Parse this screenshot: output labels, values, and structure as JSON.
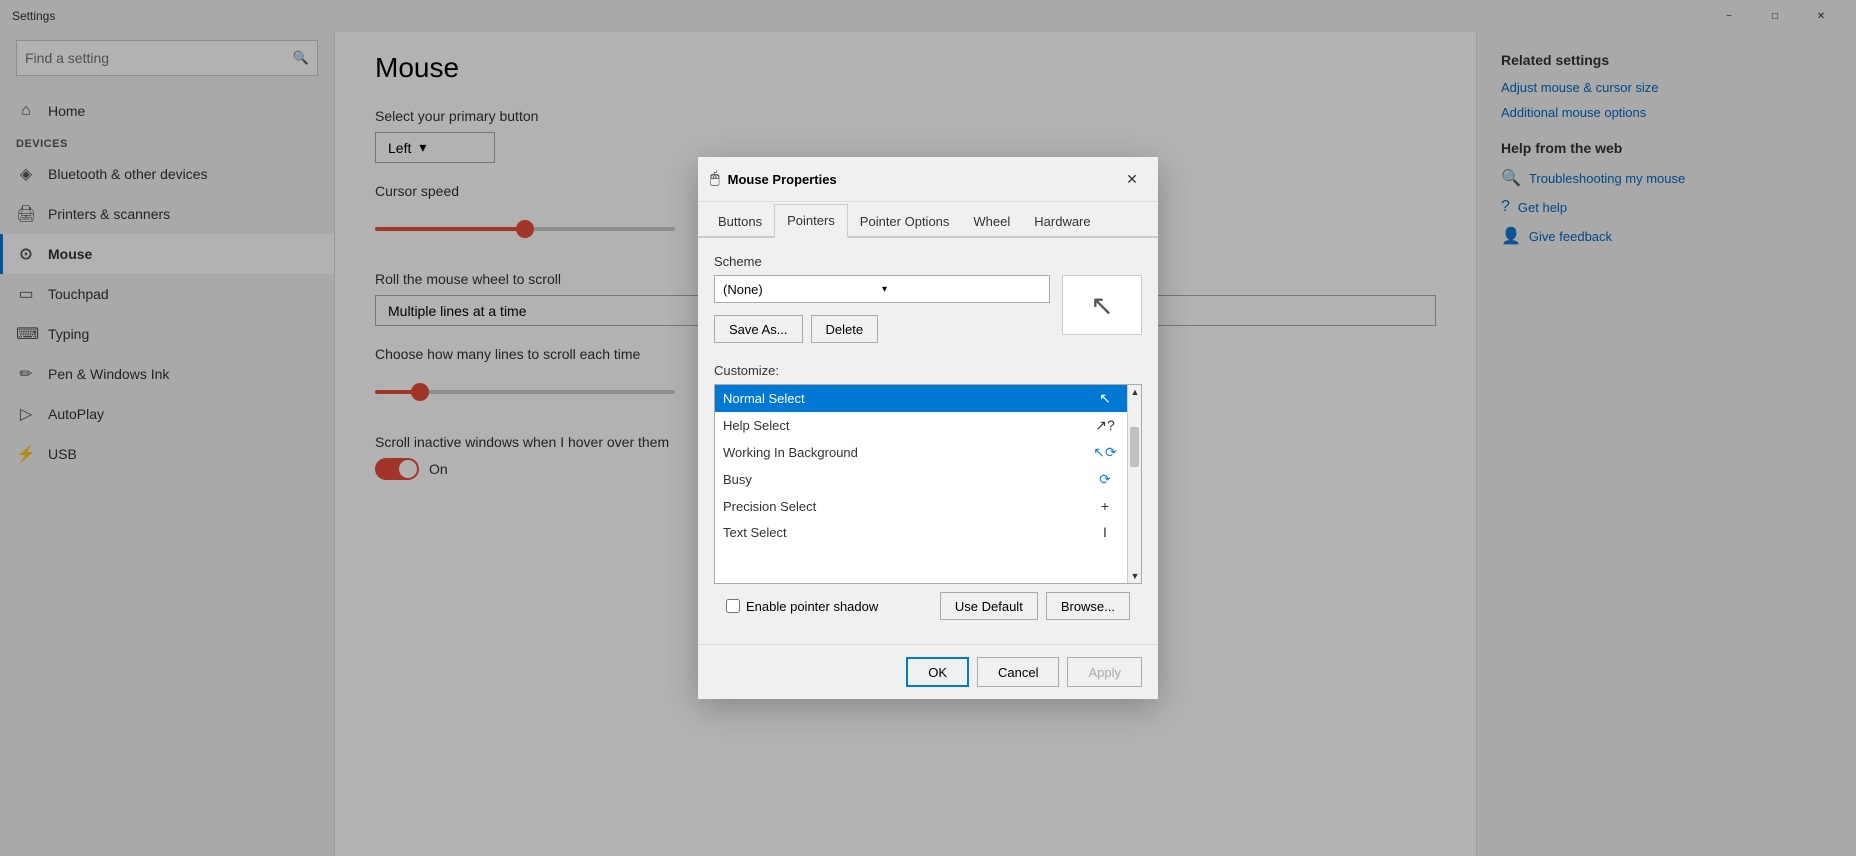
{
  "titlebar": {
    "title": "Settings",
    "minimize": "−",
    "maximize": "□",
    "close": "✕"
  },
  "sidebar": {
    "search_placeholder": "Find a setting",
    "section_label": "Devices",
    "nav_items": [
      {
        "id": "home",
        "icon": "⌂",
        "label": "Home"
      },
      {
        "id": "bluetooth",
        "icon": "◈",
        "label": "Bluetooth & other devices"
      },
      {
        "id": "printers",
        "icon": "🖨",
        "label": "Printers & scanners"
      },
      {
        "id": "mouse",
        "icon": "⊙",
        "label": "Mouse",
        "active": true
      },
      {
        "id": "touchpad",
        "icon": "▭",
        "label": "Touchpad"
      },
      {
        "id": "typing",
        "icon": "⌨",
        "label": "Typing"
      },
      {
        "id": "pen",
        "icon": "✏",
        "label": "Pen & Windows Ink"
      },
      {
        "id": "autoplay",
        "icon": "▷",
        "label": "AutoPlay"
      },
      {
        "id": "usb",
        "icon": "⚡",
        "label": "USB"
      }
    ]
  },
  "main": {
    "title": "Mouse",
    "primary_button_label": "Select your primary button",
    "primary_button_value": "Left",
    "cursor_speed_label": "Cursor speed",
    "cursor_speed_percent": 50,
    "scroll_label": "Roll the mouse wheel to scroll",
    "scroll_value": "Multiple lines at a time",
    "lines_label": "Choose how many lines to scroll each time",
    "lines_percent": 15,
    "inactive_label": "Scroll inactive windows when I hover over them",
    "inactive_value": "On"
  },
  "right_panel": {
    "related_title": "Related settings",
    "links": [
      {
        "label": "Adjust mouse & cursor size"
      },
      {
        "label": "Additional mouse options"
      }
    ],
    "help_title": "Help from the web",
    "help_links": [
      {
        "icon": "?",
        "label": "Troubleshooting my mouse"
      },
      {
        "icon": "?",
        "label": "Get help"
      },
      {
        "icon": "👤",
        "label": "Give feedback"
      }
    ]
  },
  "modal": {
    "icon": "🖱",
    "title": "Mouse Properties",
    "tabs": [
      "Buttons",
      "Pointers",
      "Pointer Options",
      "Wheel",
      "Hardware"
    ],
    "active_tab": "Pointers",
    "scheme_label": "Scheme",
    "scheme_value": "(None)",
    "save_as_label": "Save As...",
    "delete_label": "Delete",
    "customize_label": "Customize:",
    "cursor_items": [
      {
        "name": "Normal Select",
        "icon": "↖",
        "selected": true
      },
      {
        "name": "Help Select",
        "icon": "↖?"
      },
      {
        "name": "Working In Background",
        "icon": "↖⟳"
      },
      {
        "name": "Busy",
        "icon": "⟳"
      },
      {
        "name": "Precision Select",
        "icon": "+"
      },
      {
        "name": "Text Select",
        "icon": "I"
      }
    ],
    "enable_shadow_label": "Enable pointer shadow",
    "use_default_label": "Use Default",
    "browse_label": "Browse...",
    "ok_label": "OK",
    "cancel_label": "Cancel",
    "apply_label": "Apply"
  }
}
